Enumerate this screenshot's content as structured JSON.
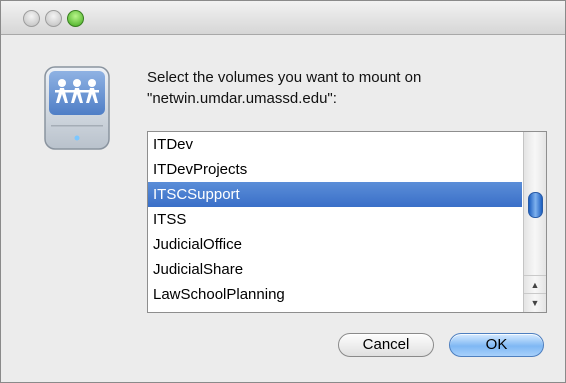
{
  "dialog": {
    "message": "Select the volumes you want to mount on \"netwin.umdar.umassd.edu\":"
  },
  "volumes": [
    {
      "label": "ITDev",
      "selected": false
    },
    {
      "label": "ITDevProjects",
      "selected": false
    },
    {
      "label": "ITSCSupport",
      "selected": true
    },
    {
      "label": "ITSS",
      "selected": false
    },
    {
      "label": "JudicialOffice",
      "selected": false
    },
    {
      "label": "JudicialShare",
      "selected": false
    },
    {
      "label": "LawSchoolPlanning",
      "selected": false
    }
  ],
  "buttons": {
    "cancel_label": "Cancel",
    "ok_label": "OK"
  },
  "icons": {
    "drive": "network-drive-icon",
    "scroll_up": "scroll-up-arrow-icon",
    "scroll_down": "scroll-down-arrow-icon"
  },
  "colors": {
    "selection": "#3a6fc8",
    "default_button": "#7fb8f4"
  }
}
